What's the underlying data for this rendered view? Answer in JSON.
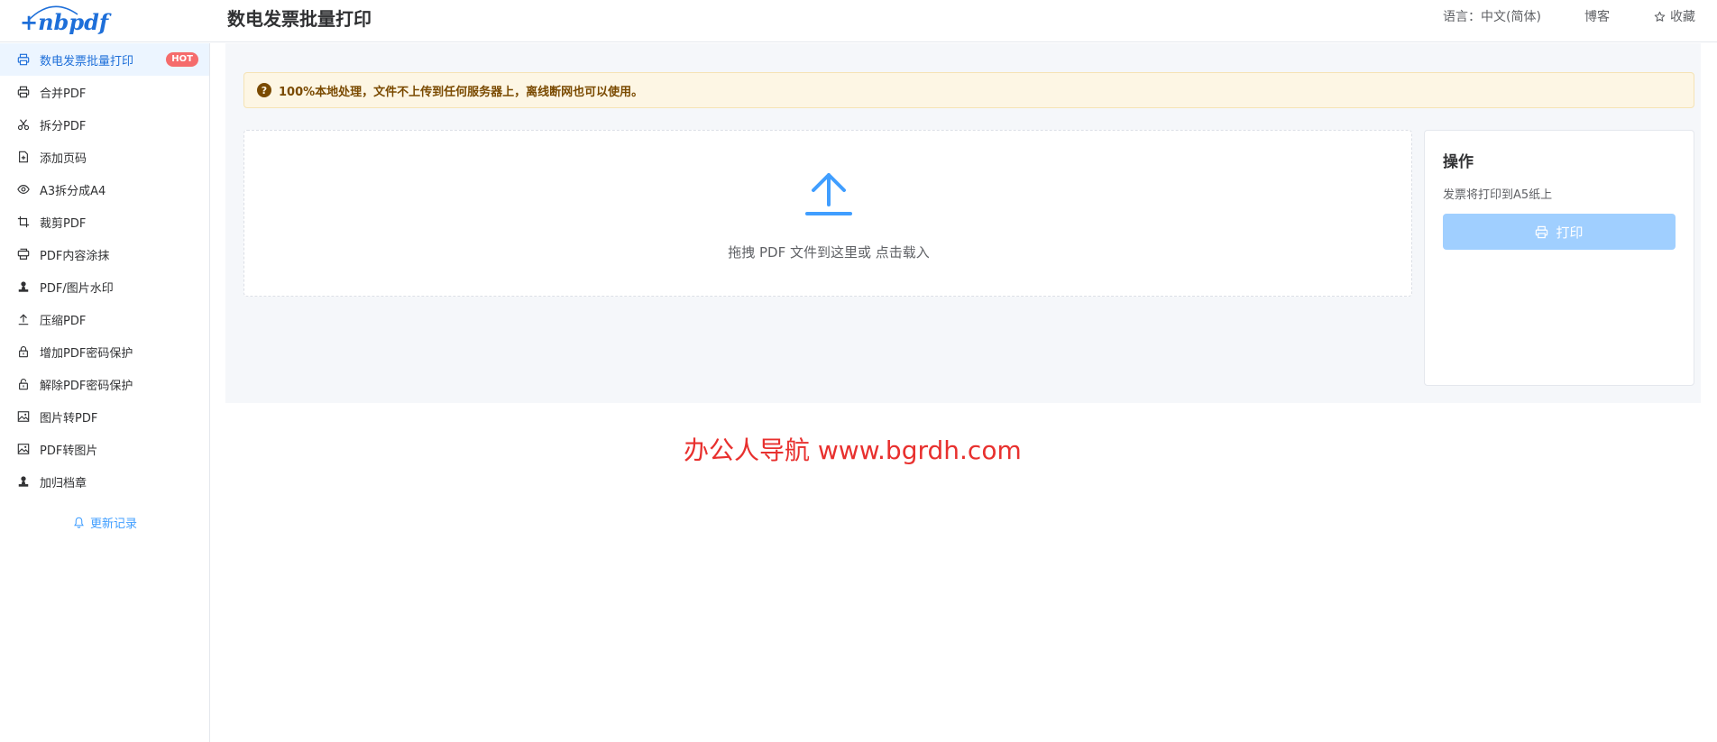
{
  "header": {
    "logo_text": "+nbpdf",
    "page_title": "数电发票批量打印",
    "language_label": "语言：中文(简体)",
    "blog_label": "博客",
    "favorite_label": "收藏"
  },
  "sidebar": {
    "items": [
      {
        "label": "数电发票批量打印",
        "icon": "printer-icon",
        "active": true,
        "badge": "HOT"
      },
      {
        "label": "合并PDF",
        "icon": "printer-icon"
      },
      {
        "label": "拆分PDF",
        "icon": "scissors-icon"
      },
      {
        "label": "添加页码",
        "icon": "file-plus-icon"
      },
      {
        "label": "A3拆分成A4",
        "icon": "eye-icon"
      },
      {
        "label": "裁剪PDF",
        "icon": "crop-icon"
      },
      {
        "label": "PDF内容涂抹",
        "icon": "eraser-icon"
      },
      {
        "label": "PDF/图片水印",
        "icon": "stamp-icon"
      },
      {
        "label": "压缩PDF",
        "icon": "upload-icon"
      },
      {
        "label": "增加PDF密码保护",
        "icon": "lock-icon"
      },
      {
        "label": "解除PDF密码保护",
        "icon": "unlock-icon"
      },
      {
        "label": "图片转PDF",
        "icon": "image-icon"
      },
      {
        "label": "PDF转图片",
        "icon": "image-icon"
      },
      {
        "label": "加归档章",
        "icon": "stamp-icon"
      }
    ],
    "update_log_label": "更新记录"
  },
  "main": {
    "notice_text": "100%本地处理，文件不上传到任何服务器上，离线断网也可以使用。",
    "dropzone_text": "拖拽 PDF 文件到这里或 点击载入",
    "ops": {
      "title": "操作",
      "description": "发票将打印到A5纸上",
      "print_label": "打印"
    }
  },
  "watermark": "办公人导航  www.bgrdh.com",
  "colors": {
    "accent": "#409eff",
    "brand": "#1e6fd9",
    "hot_badge": "#f56c6c",
    "disabled_button": "#a0cfff",
    "notice_bg": "#fdf6e4",
    "watermark": "#e8302e"
  }
}
